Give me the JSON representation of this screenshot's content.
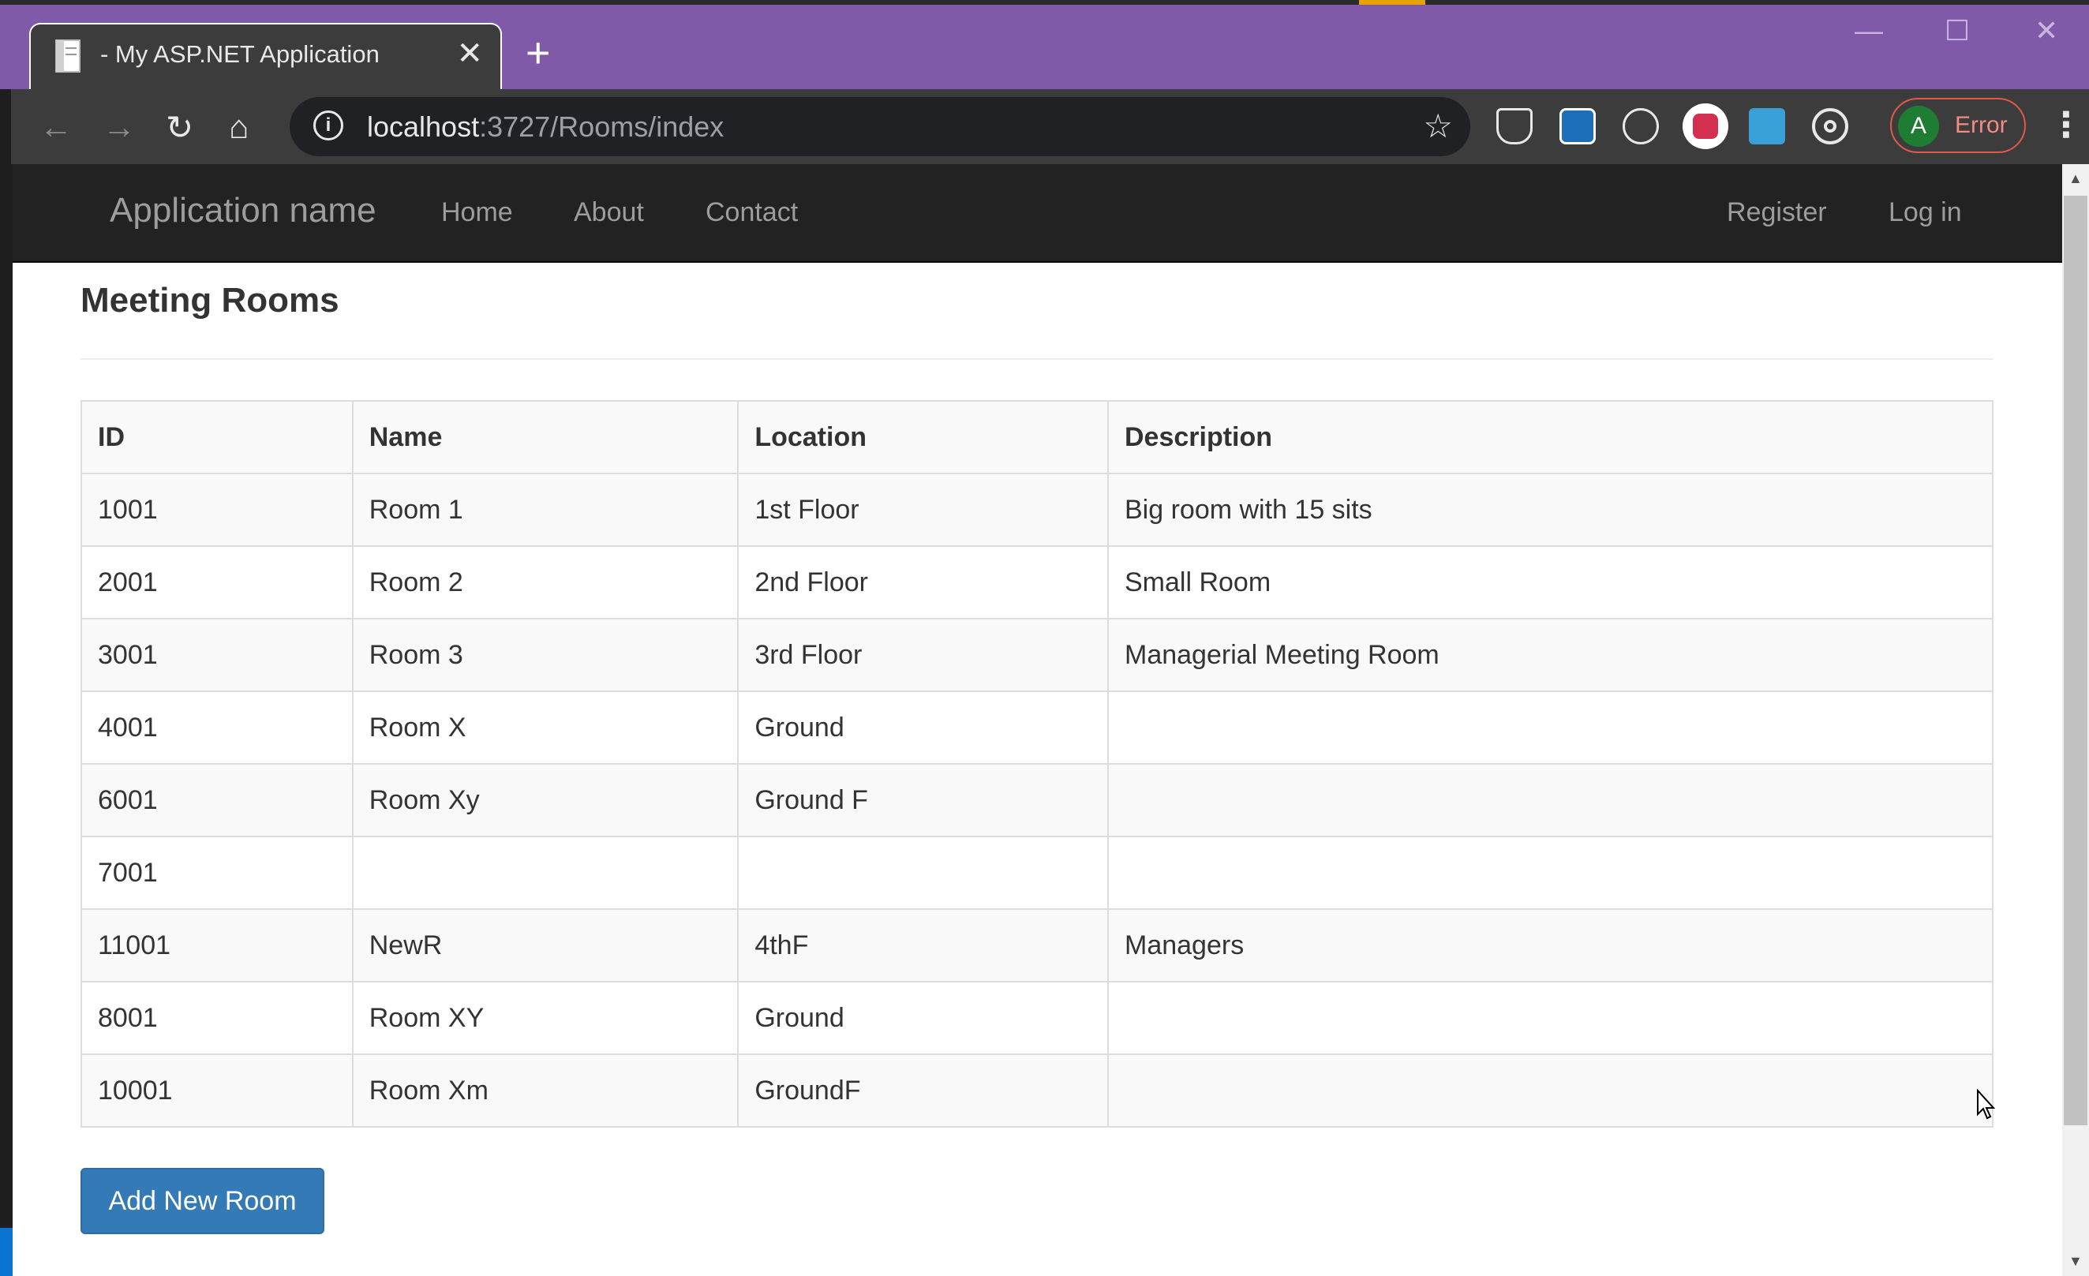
{
  "browser": {
    "tab_title": "- My ASP.NET Application",
    "tab_close": "✕",
    "new_tab": "+",
    "window_controls": {
      "minimize": "—",
      "maximize": "☐",
      "close": "✕"
    },
    "back": "←",
    "forward": "→",
    "reload": "↻",
    "home": "⌂",
    "url_host": "localhost",
    "url_rest": ":3727/Rooms/index",
    "bookmark": "☆",
    "profile_initial": "A",
    "profile_status": "Error",
    "menu": "⋮",
    "colors": {
      "tabbar": "#8059a8",
      "toolbar": "#3c3c3c",
      "error": "#f28b82"
    }
  },
  "navbar": {
    "brand": "Application name",
    "links": [
      "Home",
      "About",
      "Contact"
    ],
    "right_links": [
      "Register",
      "Log in"
    ]
  },
  "page": {
    "title": "Meeting Rooms",
    "columns": [
      "ID",
      "Name",
      "Location",
      "Description"
    ],
    "rows": [
      [
        "1001",
        "Room 1",
        "1st Floor",
        "Big room with 15 sits"
      ],
      [
        "2001",
        "Room 2",
        "2nd Floor",
        "Small Room"
      ],
      [
        "3001",
        "Room 3",
        "3rd Floor",
        "Managerial Meeting Room"
      ],
      [
        "4001",
        "Room X",
        "Ground",
        ""
      ],
      [
        "6001",
        "Room Xy",
        "Ground F",
        ""
      ],
      [
        "7001",
        "",
        "",
        ""
      ],
      [
        "11001",
        "NewR",
        "4thF",
        "Managers"
      ],
      [
        "8001",
        "Room XY",
        "Ground",
        ""
      ],
      [
        "10001",
        "Room Xm",
        "GroundF",
        ""
      ]
    ],
    "add_button": "Add New Room",
    "colors": {
      "button": "#337ab7",
      "navbar": "#222222"
    }
  }
}
